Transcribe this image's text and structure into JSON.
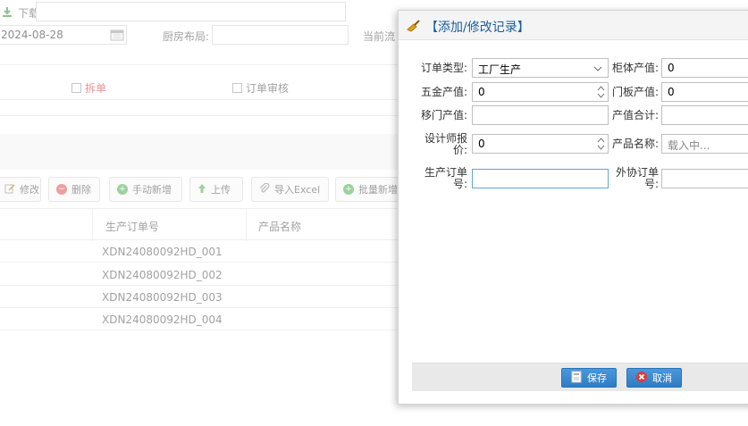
{
  "background": {
    "download_label": "下载",
    "date_value": "2024-08-28",
    "kitchen_layout_label": "厨房布局:",
    "current_flow_label": "当前流",
    "split_label": "拆单",
    "order_review_label": "订单审核",
    "toolbar": {
      "edit": "修改",
      "delete": "删除",
      "manual_add": "手动新增",
      "upload": "上传",
      "import_excel": "导入Excel",
      "batch_add": "批量新增"
    },
    "grid": {
      "columns": [
        "生产订单号",
        "产品名称"
      ],
      "rows": [
        "XDN24080092HD_001",
        "XDN24080092HD_002",
        "XDN24080092HD_003",
        "XDN24080092HD_004"
      ]
    }
  },
  "dialog": {
    "title": "【添加/修改记录】",
    "fields": {
      "order_type_label": "订单类型:",
      "order_type_value": "工厂生产",
      "cabinet_value_label": "柜体产值:",
      "cabinet_value": "0",
      "hardware_value_label": "五金产值:",
      "hardware_value": "0",
      "door_value_label": "门板产值:",
      "door_value": "0",
      "sliding_door_value_label": "移门产值:",
      "sliding_door_value": "",
      "total_value_label": "产值合计:",
      "total_value": "",
      "designer_quote_label_1": "设计师报",
      "designer_quote_label_2": "价:",
      "designer_quote_value": "0",
      "product_name_label": "产品名称:",
      "product_name_placeholder": "载入中...",
      "production_order_label_1": "生产订单",
      "production_order_label_2": "号:",
      "production_order_value": "",
      "outsource_order_label_1": "外协订单",
      "outsource_order_label_2": "号:",
      "outsource_order_value": ""
    },
    "buttons": {
      "save": "保存",
      "cancel": "取消"
    }
  }
}
